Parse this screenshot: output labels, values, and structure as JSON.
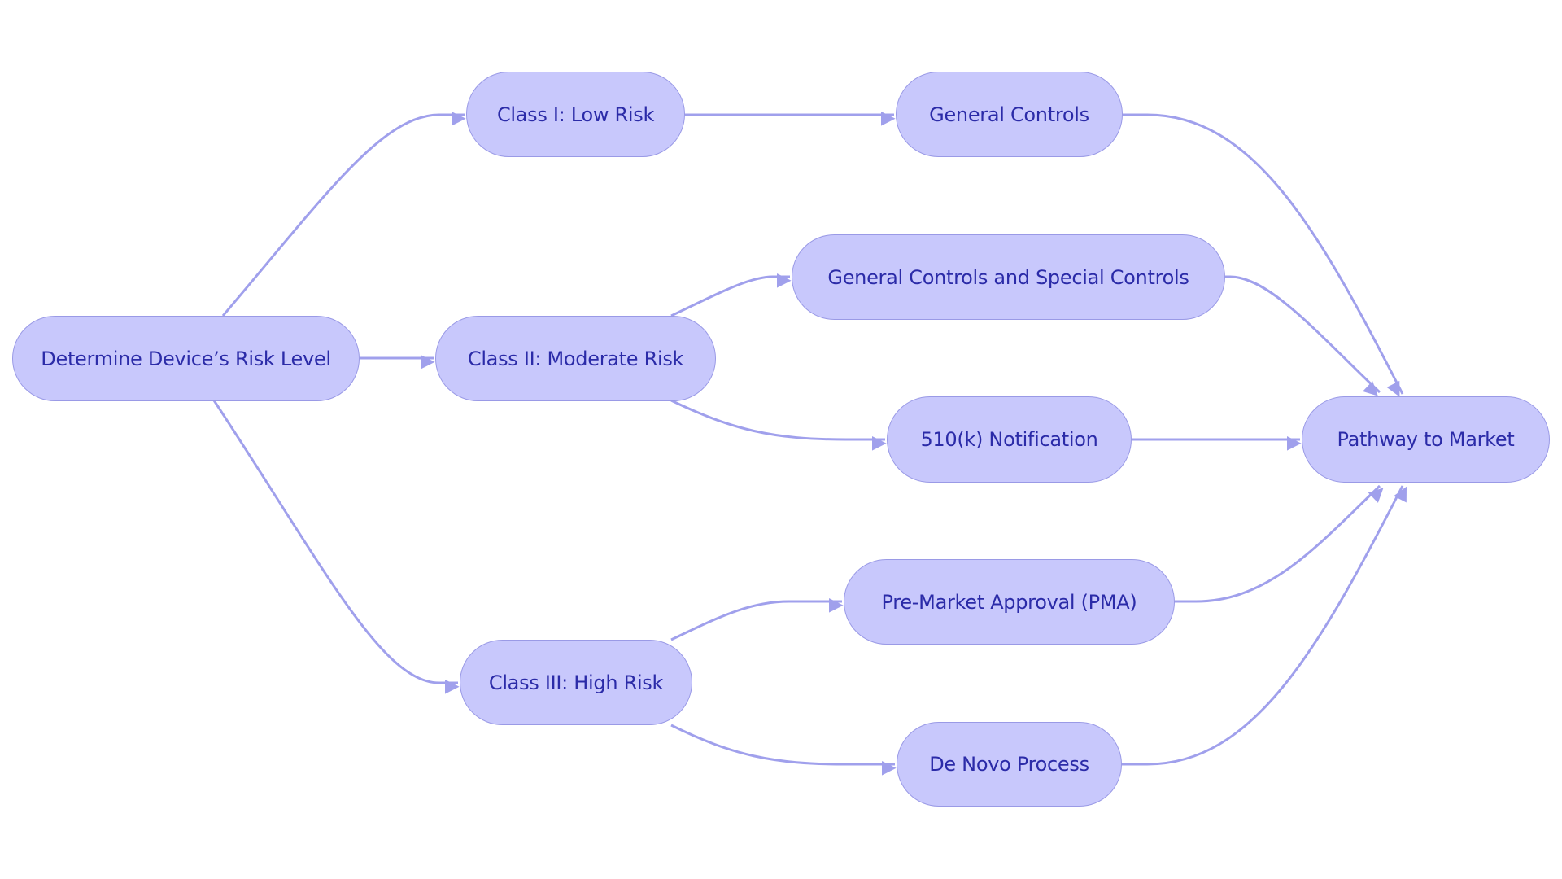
{
  "nodes": {
    "determine": "Determine Device’s Risk Level",
    "class1": "Class I: Low Risk",
    "class2": "Class II: Moderate Risk",
    "class3": "Class III: High Risk",
    "general_controls": "General Controls",
    "general_special": "General Controls and Special Controls",
    "notification_510k": "510(k) Notification",
    "pma": "Pre-Market Approval (PMA)",
    "de_novo": "De Novo Process",
    "pathway": "Pathway to Market"
  },
  "colors": {
    "node_fill": "#c8c8fc",
    "node_border": "#9a9ae6",
    "edge": "#a0a0ec",
    "text": "#2b2ba8"
  }
}
